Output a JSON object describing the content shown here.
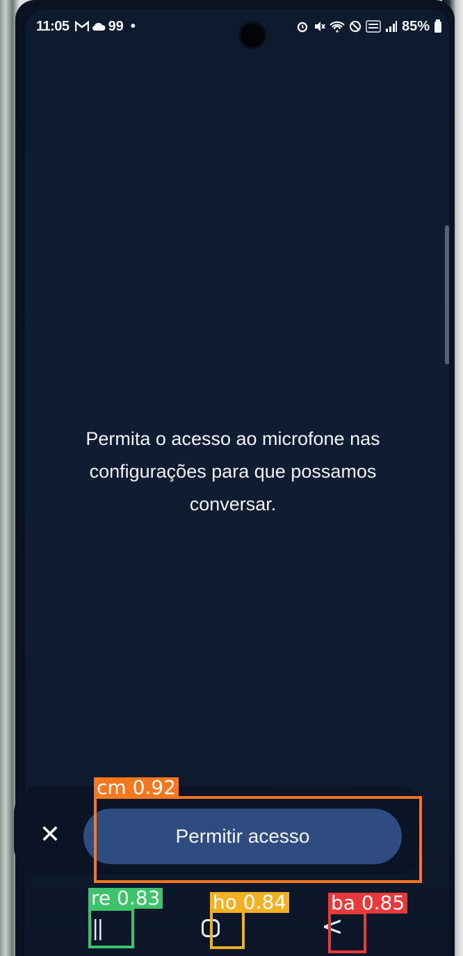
{
  "status_bar": {
    "time": "11:05",
    "notification_icons": [
      "gmail-icon",
      "cloud-icon"
    ],
    "notification_count": "99",
    "dot": "•",
    "battery": "85%",
    "right_icons": [
      "alarm-icon",
      "mute-icon",
      "wifi-icon",
      "dnd-icon",
      "volte-icon",
      "signal-icon",
      "battery-icon"
    ]
  },
  "dialog": {
    "message": "Permita o acesso ao microfone nas configurações para que possamos conversar.",
    "close_symbol": "✕",
    "primary_button": "Permitir acesso"
  },
  "nav_bar": {
    "recents_symbol": "|||",
    "back_symbol": "<"
  },
  "detections": [
    {
      "label": "cm",
      "score": "0.92",
      "text": "cm  0.92",
      "color": "#f7771f"
    },
    {
      "label": "re",
      "score": "0.83",
      "text": "re  0.83",
      "color": "#3cc46a"
    },
    {
      "label": "ho",
      "score": "0.84",
      "text": "ho  0.84",
      "color": "#f4b023"
    },
    {
      "label": "ba",
      "score": "0.85",
      "text": "ba  0.85",
      "color": "#e83a3a"
    }
  ]
}
